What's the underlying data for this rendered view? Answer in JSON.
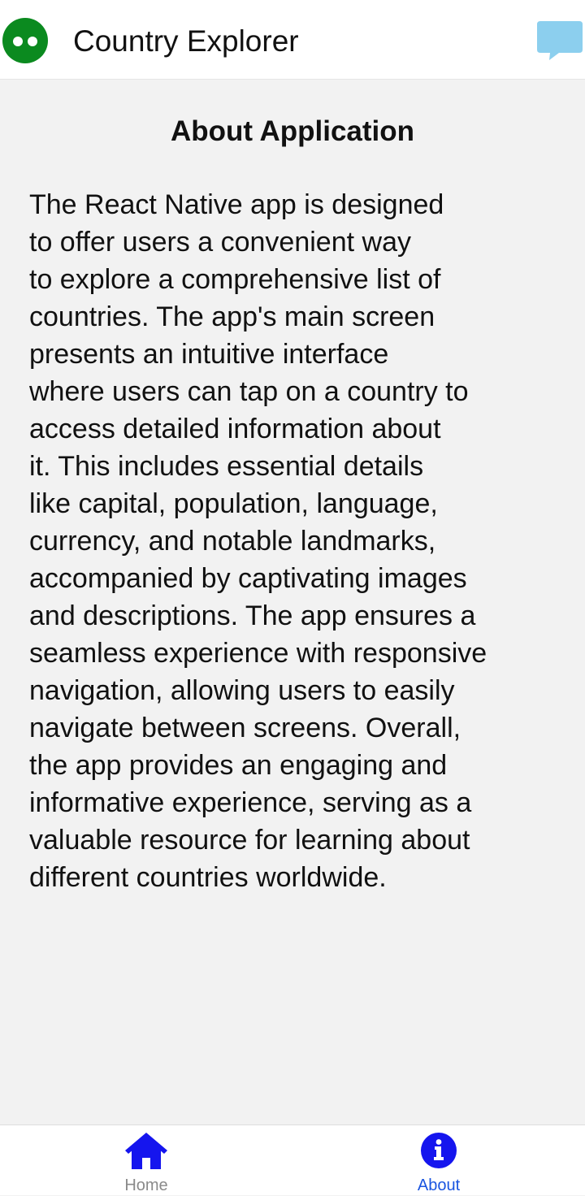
{
  "header": {
    "title": "Country Explorer",
    "logo_icon": "owl-eyes-icon",
    "chat_icon": "chat-bubble-icon"
  },
  "main": {
    "heading": "About Application",
    "body_lines": [
      "The React Native app is designed",
      "to offer users a convenient way",
      "to explore a comprehensive list of",
      "countries. The app's main screen",
      "presents an intuitive interface",
      "where users can tap on a country to",
      "access detailed information about",
      "it. This includes essential details",
      "like capital, population, language,",
      "currency, and notable landmarks,",
      "accompanied by captivating images",
      "and descriptions. The app ensures a",
      "seamless experience with responsive",
      "navigation, allowing users to easily",
      "navigate between screens. Overall,",
      "the app provides an engaging and",
      "informative experience, serving as a",
      "valuable resource for learning about",
      "different countries worldwide."
    ]
  },
  "tabs": [
    {
      "label": "Home",
      "icon": "home-icon",
      "active": false
    },
    {
      "label": "About",
      "icon": "info-icon",
      "active": true
    }
  ],
  "colors": {
    "logo_green": "#0b8a1f",
    "chat_blue": "#8ccfee",
    "tab_icon_blue": "#1515ee",
    "active_label": "#1a55e0",
    "inactive_label": "#8a8a8a",
    "background": "#f2f2f2"
  }
}
